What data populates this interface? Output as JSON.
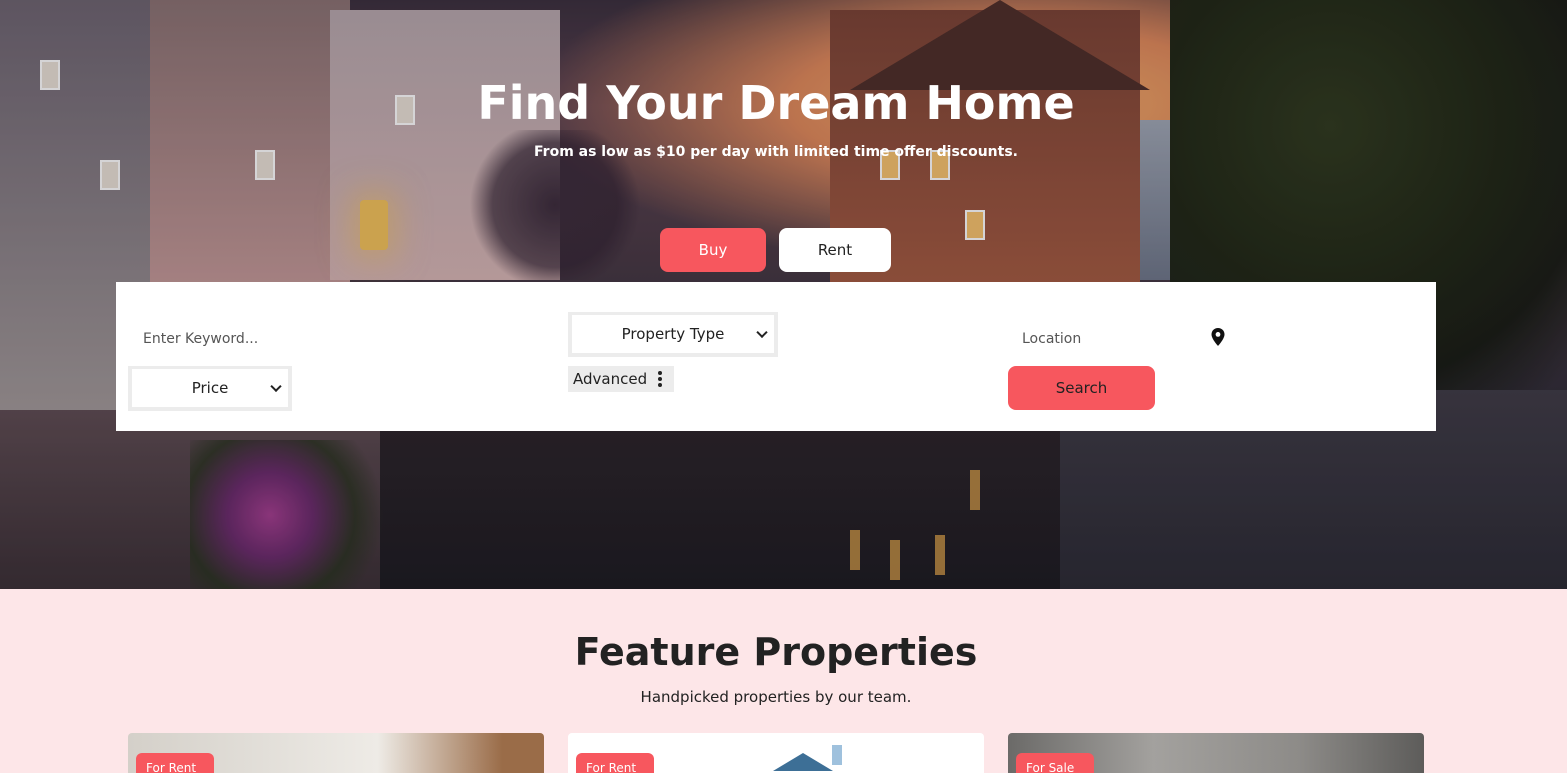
{
  "hero": {
    "title": "Find Your Dream Home",
    "subtitle": "From as low as $10 per day with limited time offer discounts."
  },
  "tabs": {
    "buy": "Buy",
    "rent": "Rent",
    "active": "Buy"
  },
  "search": {
    "keyword_placeholder": "Enter Keyword...",
    "property_type": "Property Type",
    "price": "Price",
    "advanced": "Advanced",
    "location_placeholder": "Location",
    "search_button": "Search"
  },
  "features": {
    "title": "Feature Properties",
    "subtitle": "Handpicked properties by our team.",
    "cards": [
      {
        "badge": "For Rent"
      },
      {
        "badge": "For Rent"
      },
      {
        "badge": "For Sale"
      }
    ]
  },
  "colors": {
    "accent": "#f7575e",
    "section_bg": "#fde6e8",
    "panel_bg": "#ffffff"
  }
}
